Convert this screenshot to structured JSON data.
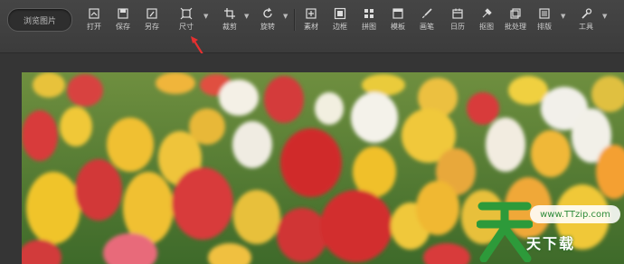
{
  "toolbar": {
    "browse_label": "浏览图片",
    "tools": [
      {
        "label": "打开",
        "icon": "open-icon"
      },
      {
        "label": "保存",
        "icon": "save-icon"
      },
      {
        "label": "另存",
        "icon": "save-as-icon"
      },
      {
        "label": "尺寸",
        "icon": "resize-icon"
      },
      {
        "label": "裁剪",
        "icon": "crop-icon"
      },
      {
        "label": "旋转",
        "icon": "rotate-icon"
      },
      {
        "label": "素材",
        "icon": "material-icon"
      },
      {
        "label": "边框",
        "icon": "frame-icon"
      },
      {
        "label": "拼图",
        "icon": "collage-icon"
      },
      {
        "label": "模板",
        "icon": "template-icon"
      },
      {
        "label": "画笔",
        "icon": "brush-icon"
      },
      {
        "label": "日历",
        "icon": "calendar-icon"
      },
      {
        "label": "抠图",
        "icon": "cutout-icon"
      },
      {
        "label": "批处理",
        "icon": "batch-icon"
      },
      {
        "label": "排版",
        "icon": "layout-icon"
      },
      {
        "label": "工具",
        "icon": "tools-icon"
      }
    ]
  },
  "watermark": {
    "url": "www.TTzip.com",
    "text": "天下载"
  },
  "colors": {
    "toolbar_bg": "#424242",
    "arrow": "#e53030",
    "watermark_green": "#2e8b3a"
  }
}
